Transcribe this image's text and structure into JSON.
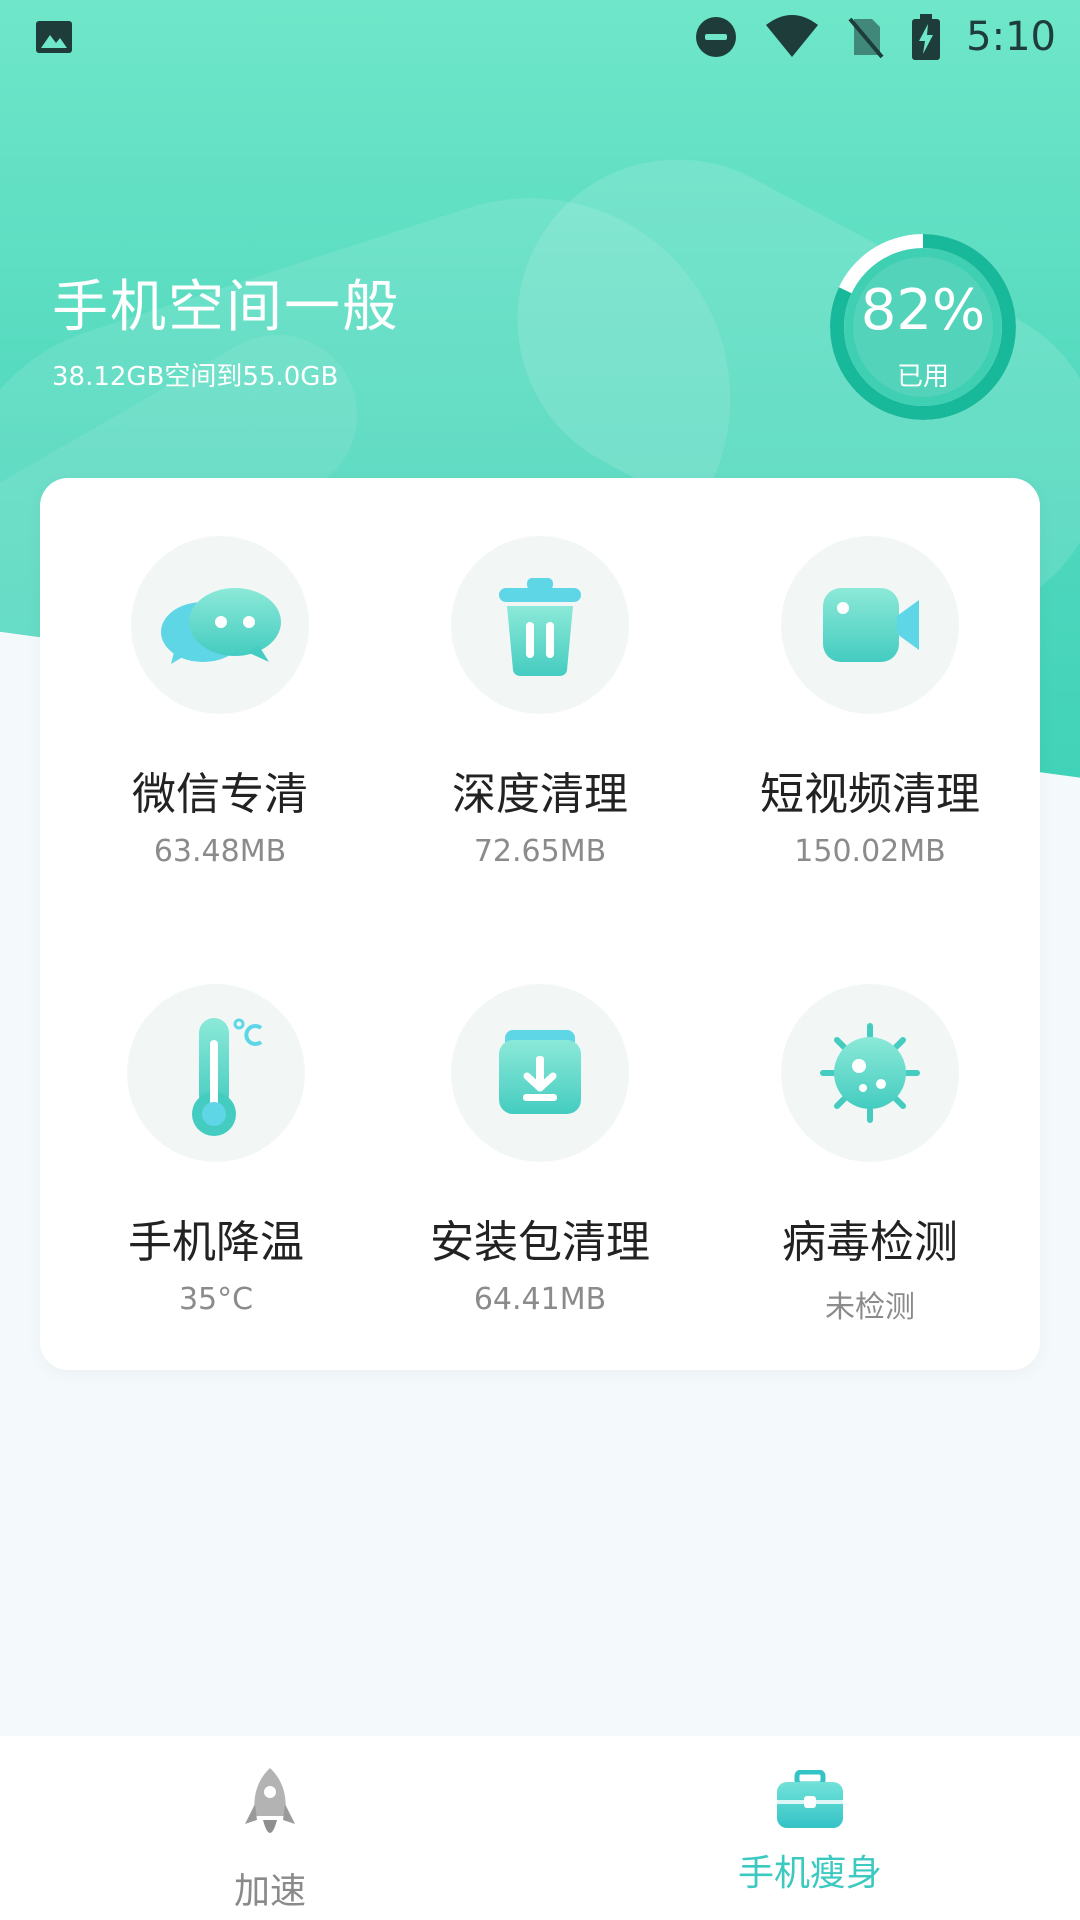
{
  "status_bar": {
    "time": "5:10",
    "icons": [
      "image-icon",
      "do-not-disturb-icon",
      "wifi-icon",
      "no-sim-icon",
      "battery-charging-icon"
    ]
  },
  "header": {
    "title": "手机空间一般",
    "subtitle": "38.12GB空间到55.0GB",
    "usage_percent": "82%",
    "usage_fraction": 0.82,
    "usage_label": "已用"
  },
  "colors": {
    "accent": "#3fd2b8",
    "active_tab": "#3cc9c0"
  },
  "tools": [
    {
      "name": "微信专清",
      "value": "63.48MB",
      "icon": "wechat-icon"
    },
    {
      "name": "深度清理",
      "value": "72.65MB",
      "icon": "trash-icon"
    },
    {
      "name": "短视频清理",
      "value": "150.02MB",
      "icon": "video-camera-icon"
    },
    {
      "name": "手机降温",
      "value": "35°C",
      "icon": "thermometer-icon"
    },
    {
      "name": "安装包清理",
      "value": "64.41MB",
      "icon": "package-download-icon"
    },
    {
      "name": "病毒检测",
      "value": "未检测",
      "icon": "virus-icon"
    }
  ],
  "bottom_nav": {
    "items": [
      {
        "label": "加速",
        "icon": "rocket-icon",
        "active": false
      },
      {
        "label": "手机瘦身",
        "icon": "toolbox-icon",
        "active": true
      }
    ]
  }
}
